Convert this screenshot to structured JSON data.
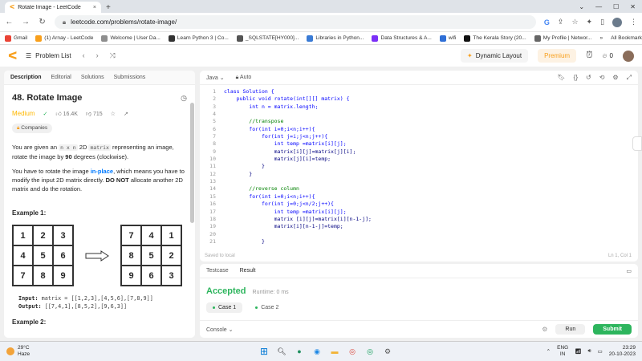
{
  "browser": {
    "tab_title": "Rotate Image - LeetCode",
    "url": "leetcode.com/problems/rotate-image/",
    "bookmarks": [
      {
        "label": "Gmail",
        "color": "#ea4335"
      },
      {
        "label": "(1) Arnay - LeetCode",
        "color": "#f89f1b"
      },
      {
        "label": "Welcome | User Da...",
        "color": "#8e8e8e"
      },
      {
        "label": "Learn Python 3 | Co...",
        "color": "#333333"
      },
      {
        "label": "_SQLSTATE[HY000]...",
        "color": "#555555"
      },
      {
        "label": "Libraries in Python...",
        "color": "#3a7bd5"
      },
      {
        "label": "Data Structures & A...",
        "color": "#7b2ff7"
      },
      {
        "label": "wifi",
        "color": "#2f6fd6"
      },
      {
        "label": "The Kerala Story (20...",
        "color": "#111111"
      },
      {
        "label": "My Profile | Networ...",
        "color": "#666666"
      }
    ],
    "all_bookmarks": "All Bookmarks"
  },
  "nav": {
    "problem_list": "Problem List",
    "dynamic_layout": "Dynamic Layout",
    "premium": "Premium",
    "notifications": "0"
  },
  "left": {
    "tabs": [
      "Description",
      "Editorial",
      "Solutions",
      "Submissions"
    ],
    "title": "48. Rotate Image",
    "difficulty": "Medium",
    "likes": "16.4K",
    "dislikes": "715",
    "companies": "Companies",
    "desc1_a": "You are given an ",
    "desc1_code": "n x n",
    "desc1_b": " 2D ",
    "desc1_code2": "matrix",
    "desc1_c": " representing an image, rotate the image by ",
    "desc1_bold": "90",
    "desc1_d": " degrees (clockwise).",
    "desc2_a": "You have to rotate the image ",
    "desc2_link": "in-place",
    "desc2_b": ", which means you have to modify the input 2D matrix directly. ",
    "desc2_bold": "DO NOT",
    "desc2_c": " allocate another 2D matrix and do the rotation.",
    "example1": "Example 1:",
    "matrix_in": [
      "1",
      "2",
      "3",
      "4",
      "5",
      "6",
      "7",
      "8",
      "9"
    ],
    "matrix_out": [
      "7",
      "4",
      "1",
      "8",
      "5",
      "2",
      "9",
      "6",
      "3"
    ],
    "input_label": "Input:",
    "input_value": " matrix = [[1,2,3],[4,5,6],[7,8,9]]",
    "output_label": "Output:",
    "output_value": " [[7,4,1],[8,5,2],[9,6,3]]",
    "example2": "Example 2:"
  },
  "editor": {
    "language": "Java",
    "mode": "Auto",
    "saved": "Saved to local",
    "position": "Ln 1, Col 1",
    "lines": [
      "class Solution {",
      "    public void rotate(int[][] matrix) {",
      "        int n = matrix.length;",
      "",
      "        //transpose",
      "        for(int i=0;i<n;i++){",
      "            for(int j=i;j<n;j++){",
      "                int temp =matrix[i][j];",
      "                matrix[i][j]=matrix[j][i];",
      "                matrix[j][i]=temp;",
      "            }",
      "        }",
      "",
      "        //reverse column",
      "        for(int i=0;i<n;i++){",
      "            for(int j=0;j<n/2;j++){",
      "                int temp =matrix[i][j];",
      "                matrix [i][j]=matrix[i][n-1-j];",
      "                matrix[i][n-1-j]=temp;",
      "            ",
      "            }"
    ]
  },
  "result": {
    "tabs": [
      "Testcase",
      "Result"
    ],
    "status": "Accepted",
    "runtime": "Runtime: 0 ms",
    "cases": [
      "Case 1",
      "Case 2"
    ],
    "console": "Console",
    "run": "Run",
    "submit": "Submit"
  },
  "taskbar": {
    "temp": "29°C",
    "weather": "Haze",
    "lang": "ENG",
    "region": "IN",
    "time": "23:29",
    "date": "20-10-2023"
  },
  "colors": {
    "accent_orange": "#f89f1b",
    "accepted_green": "#2db55d",
    "medium_yellow": "#ffb800",
    "link_blue": "#007aff"
  }
}
